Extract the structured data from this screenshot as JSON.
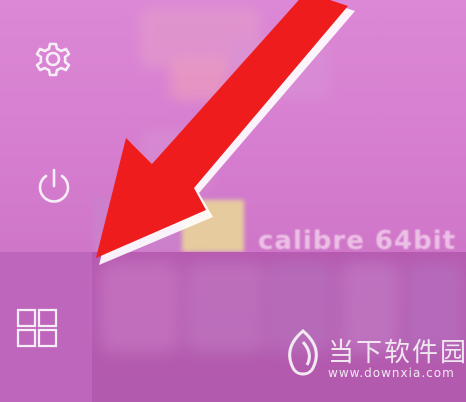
{
  "start_menu": {
    "rail_items": [
      {
        "name": "settings",
        "icon": "gear-icon"
      },
      {
        "name": "power",
        "icon": "power-icon"
      }
    ],
    "app_label": "calibre 64bit"
  },
  "taskbar": {
    "start_button_icon": "windows-logo-icon"
  },
  "annotation": {
    "type": "arrow",
    "color": "#ee1c1c",
    "points_to": "start-button"
  },
  "watermark": {
    "name": "当下软件园",
    "url": "www.downxia.com"
  },
  "colors": {
    "start_menu_bg": "#d77fd0",
    "taskbar_bg": "#b65ab0",
    "arrow_red": "#ee1c1c",
    "icon_stroke": "#f6eef6"
  }
}
